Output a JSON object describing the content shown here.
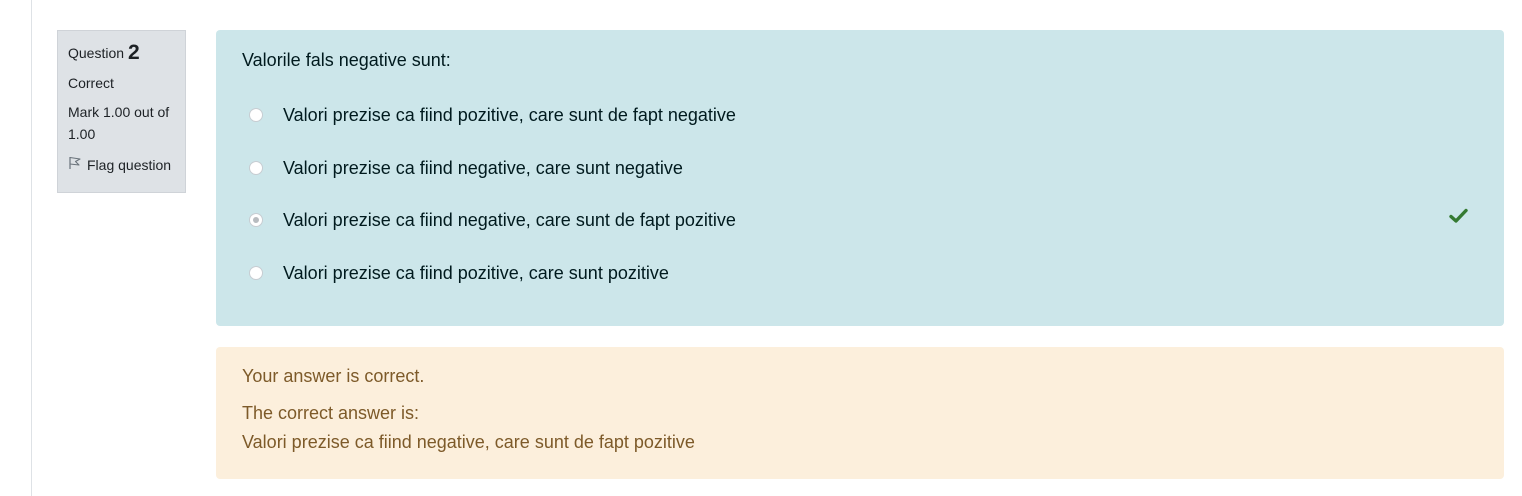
{
  "question": {
    "label": "Question",
    "number": "2",
    "state": "Correct",
    "grade": "Mark 1.00 out of 1.00",
    "flag_label": "Flag question",
    "flag_icon": "flag-outline-icon"
  },
  "formulation": {
    "text": "Valorile fals negative sunt:",
    "options": [
      {
        "label": "Valori prezise ca fiind pozitive, care sunt de fapt negative",
        "selected": false
      },
      {
        "label": "Valori prezise ca fiind negative, care sunt negative",
        "selected": false
      },
      {
        "label": "Valori prezise ca fiind negative, care sunt de fapt pozitive",
        "selected": true,
        "mark": "correct"
      },
      {
        "label": "Valori prezise ca fiind pozitive, care sunt pozitive",
        "selected": false
      }
    ],
    "correct_icon": "check-icon"
  },
  "feedback": {
    "specific": "Your answer is correct.",
    "right_answer_intro": "The correct answer is:",
    "right_answer": "Valori prezise ca fiind negative, care sunt de fapt pozitive"
  },
  "colors": {
    "info_bg": "#dee2e6",
    "formulation_bg": "#cce6ea",
    "outcome_bg": "#fcefdc",
    "outcome_text": "#7d5a29",
    "correct_green": "#357a32"
  }
}
